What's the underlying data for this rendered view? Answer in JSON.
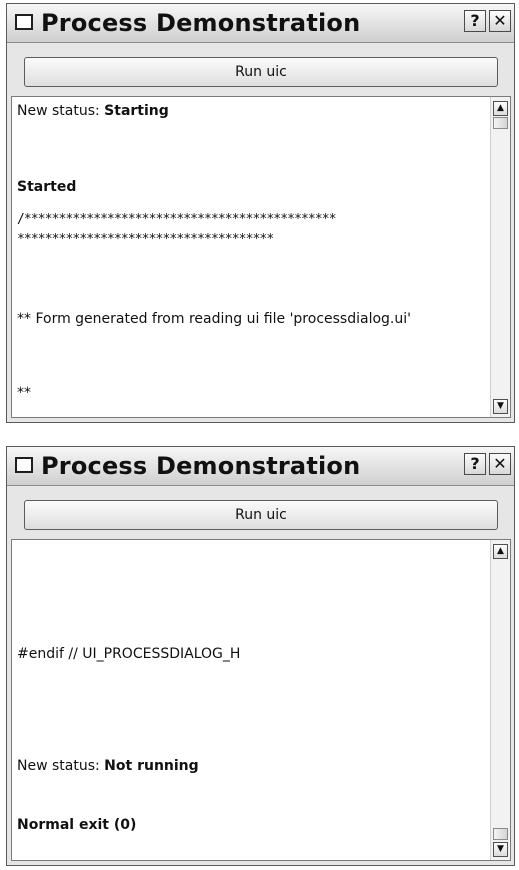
{
  "windows": [
    {
      "title": "Process Demonstration",
      "help_glyph": "?",
      "close_glyph": "✕",
      "run_button_label": "Run uic",
      "scroll_fraction": 0.0,
      "output": {
        "status_prefix": "New status: ",
        "status_value": "Starting",
        "started": "Started",
        "stars_line1": "/*********************************************",
        "stars_line2": "*************************************",
        "form_generated": "** Form generated from reading ui file 'processdialog.ui'",
        "double_star": "**"
      }
    },
    {
      "title": "Process Demonstration",
      "help_glyph": "?",
      "close_glyph": "✕",
      "run_button_label": "Run uic",
      "scroll_fraction": 1.0,
      "output": {
        "endif_line": "#endif // UI_PROCESSDIALOG_H",
        "status_prefix": "New status: ",
        "status_value": "Not running",
        "exit_line": "Normal exit (0)"
      }
    }
  ],
  "icons": {
    "window": "window-icon",
    "help": "help-icon",
    "close": "close-icon",
    "scroll_up": "scroll-up-arrow-icon",
    "scroll_down": "scroll-down-arrow-icon"
  }
}
